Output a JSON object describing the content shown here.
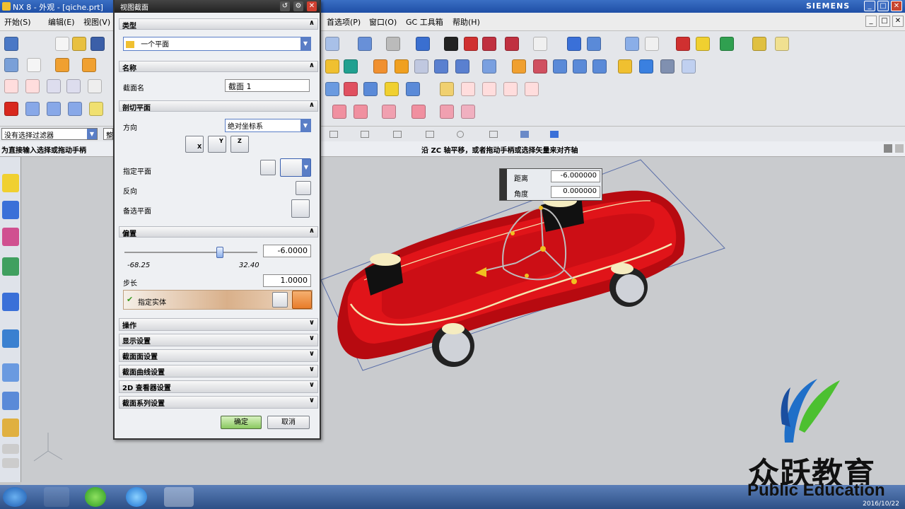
{
  "window": {
    "title": "NX 8 - 外观 - [qiche.prt]",
    "brand": "SIEMENS",
    "min": "_",
    "max": "□",
    "close": "✕"
  },
  "menubar": {
    "items": [
      "开始(S)",
      "编辑(E)",
      "视图(V)",
      "首选项(P)",
      "窗口(O)",
      "GC 工具箱",
      "帮助(H)"
    ]
  },
  "selection_bar": {
    "filter": "没有选择过滤器",
    "scope": "整"
  },
  "hint": {
    "left": "为直接输入选择或拖动手柄",
    "center": "沿 ZC 轴平移，或者拖动手柄或选择矢量来对齐轴"
  },
  "dialog": {
    "title": "视图截面",
    "sections": {
      "type": {
        "header": "类型",
        "value": "一个平面"
      },
      "name": {
        "header": "名称",
        "label": "截面名",
        "value": "截面 1"
      },
      "plane": {
        "header": "剖切平面",
        "direction_label": "方向",
        "direction_value": "绝对坐标系",
        "specify_plane": "指定平面",
        "reverse": "反向",
        "alt_plane": "备选平面"
      },
      "offset": {
        "header": "偏置",
        "value": "-6.0000",
        "min": "-68.25",
        "max": "32.40",
        "step_label": "步长",
        "step_value": "1.0000",
        "snap_label": "指定实体"
      },
      "collapsed": [
        "操作",
        "显示设置",
        "截面面设置",
        "截面曲线设置",
        "2D 查看器设置",
        "截面系列设置"
      ]
    },
    "buttons": {
      "ok": "确定",
      "cancel": "取消"
    },
    "slider_fraction": 0.73
  },
  "viewport": {
    "screen_input": {
      "distance_label": "距离",
      "distance_value": "-6.000000",
      "angle_label": "角度",
      "angle_value": "0.000000"
    }
  },
  "taskbar": {
    "date": "2016/10/22"
  },
  "watermark": {
    "cn": "众跃教育",
    "en": "Public Education"
  },
  "colors": {
    "car_body": "#d4101a",
    "title_blue": "#1f4fa6",
    "accent_orange": "#e87c2a"
  }
}
